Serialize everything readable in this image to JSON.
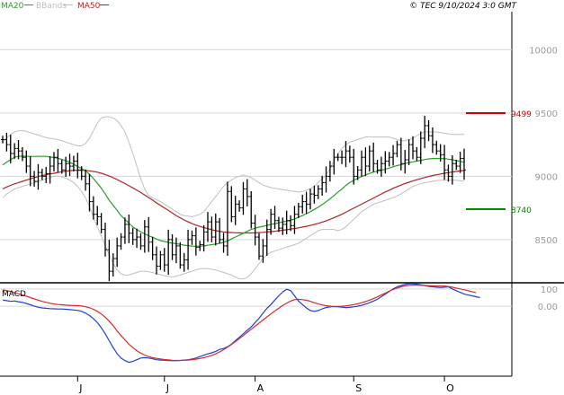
{
  "header": {
    "legend": [
      {
        "label": "MA20",
        "color": "#2a9d2a"
      },
      {
        "label": "BBands",
        "color": "#bfbfbf"
      },
      {
        "label": "MA50",
        "color": "#b22222"
      }
    ],
    "copyright": "© TEC 9/10/2024 3:0 GMT"
  },
  "chart_data": [
    {
      "type": "line",
      "panel": "price",
      "title": "",
      "ylim": [
        8180,
        10300
      ],
      "y_ticks": [
        {
          "value": 10000,
          "label": "10000"
        },
        {
          "value": 9500,
          "label": "9500"
        },
        {
          "value": 9000,
          "label": "9000"
        },
        {
          "value": 8500,
          "label": "8500"
        }
      ],
      "x_ticks": [
        "J",
        "J",
        "A",
        "S",
        "O"
      ],
      "n_sessions": 118,
      "tick_sessions": [
        19,
        41,
        64,
        89,
        112
      ],
      "levels": [
        {
          "label": "9499",
          "value": 9499,
          "color": "#cc0000"
        },
        {
          "label": "8740",
          "value": 8740,
          "color": "#008800"
        }
      ],
      "series": [
        {
          "name": "close",
          "color": "#000000",
          "values": [
            9290,
            9250,
            9180,
            9220,
            9200,
            9150,
            9080,
            9000,
            8960,
            9030,
            9000,
            9020,
            9080,
            9150,
            9100,
            9050,
            9100,
            9080,
            9120,
            9050,
            9000,
            8940,
            8800,
            8700,
            8680,
            8580,
            8420,
            8250,
            8350,
            8450,
            8520,
            8620,
            8550,
            8500,
            8520,
            8450,
            8600,
            8480,
            8380,
            8290,
            8380,
            8300,
            8500,
            8380,
            8450,
            8300,
            8340,
            8500,
            8530,
            8440,
            8460,
            8560,
            8640,
            8520,
            8640,
            8500,
            8450,
            8880,
            8680,
            8780,
            8750,
            8900,
            8840,
            8630,
            8520,
            8370,
            8450,
            8580,
            8700,
            8650,
            8590,
            8620,
            8650,
            8610,
            8700,
            8760,
            8800,
            8780,
            8860,
            8850,
            8900,
            8950,
            9000,
            9080,
            9150,
            9150,
            9150,
            9200,
            9150,
            9000,
            9050,
            9150,
            9080,
            9200,
            9100,
            9050,
            9100,
            9120,
            9150,
            9180,
            9250,
            9100,
            9130,
            9250,
            9200,
            9150,
            9300,
            9400,
            9320,
            9250,
            9200,
            9170,
            9050,
            9000,
            9100,
            9080,
            9140,
            9050
          ]
        },
        {
          "name": "MA20",
          "color": "#2a9d2a",
          "values": [
            9090,
            9112,
            9132,
            9150,
            9158,
            9159,
            9158,
            9157,
            9157,
            9157,
            9157,
            9157,
            9152,
            9148,
            9142,
            9133,
            9124,
            9110,
            9095,
            9077,
            9061,
            9042,
            9015,
            8982,
            8946,
            8906,
            8860,
            8810,
            8770,
            8730,
            8690,
            8660,
            8630,
            8600,
            8580,
            8560,
            8545,
            8530,
            8518,
            8505,
            8492,
            8485,
            8478,
            8472,
            8468,
            8462,
            8456,
            8452,
            8449,
            8448,
            8448,
            8450,
            8455,
            8460,
            8465,
            8470,
            8478,
            8490,
            8505,
            8520,
            8535,
            8550,
            8565,
            8580,
            8590,
            8598,
            8605,
            8612,
            8620,
            8626,
            8632,
            8640,
            8645,
            8653,
            8662,
            8676,
            8690,
            8705,
            8720,
            8738,
            8756,
            8776,
            8798,
            8822,
            8848,
            8874,
            8900,
            8927,
            8950,
            8968,
            8984,
            8998,
            9010,
            9022,
            9033,
            9040,
            9047,
            9055,
            9065,
            9075,
            9084,
            9092,
            9100,
            9108,
            9114,
            9120,
            9126,
            9132,
            9137,
            9140,
            9141,
            9140,
            9139,
            9135,
            9130,
            9124,
            9118,
            9110
          ]
        },
        {
          "name": "MA50",
          "color": "#b22222",
          "values": [
            8900,
            8915,
            8928,
            8940,
            8950,
            8960,
            8970,
            8980,
            8990,
            8998,
            9005,
            9012,
            9018,
            9024,
            9030,
            9036,
            9040,
            9044,
            9047,
            9048,
            9048,
            9046,
            9043,
            9038,
            9032,
            9024,
            9014,
            9002,
            8988,
            8974,
            8958,
            8942,
            8925,
            8908,
            8890,
            8872,
            8852,
            8832,
            8812,
            8790,
            8770,
            8750,
            8730,
            8710,
            8690,
            8672,
            8655,
            8640,
            8626,
            8614,
            8604,
            8594,
            8586,
            8578,
            8571,
            8565,
            8560,
            8557,
            8556,
            8554,
            8553,
            8552,
            8552,
            8552,
            8553,
            8555,
            8557,
            8560,
            8563,
            8566,
            8570,
            8574,
            8578,
            8583,
            8588,
            8593,
            8599,
            8605,
            8612,
            8620,
            8628,
            8638,
            8648,
            8660,
            8672,
            8686,
            8700,
            8716,
            8732,
            8748,
            8764,
            8780,
            8796,
            8812,
            8828,
            8844,
            8860,
            8876,
            8890,
            8905,
            8918,
            8930,
            8942,
            8953,
            8963,
            8973,
            8982,
            8990,
            8998,
            9006,
            9012,
            9018,
            9024,
            9029,
            9034,
            9038,
            9042,
            9046
          ]
        },
        {
          "name": "BBands upper",
          "color": "#bfbfbf",
          "values": [
            9270,
            9300,
            9330,
            9350,
            9360,
            9360,
            9355,
            9345,
            9335,
            9325,
            9315,
            9305,
            9300,
            9295,
            9290,
            9280,
            9270,
            9260,
            9250,
            9240,
            9240,
            9260,
            9300,
            9360,
            9420,
            9460,
            9470,
            9470,
            9460,
            9440,
            9400,
            9350,
            9270,
            9180,
            9080,
            8980,
            8900,
            8850,
            8830,
            8815,
            8800,
            8780,
            8760,
            8740,
            8720,
            8700,
            8690,
            8685,
            8680,
            8690,
            8700,
            8720,
            8760,
            8800,
            8840,
            8880,
            8920,
            8950,
            8970,
            8990,
            9000,
            9010,
            9000,
            8990,
            8970,
            8950,
            8930,
            8920,
            8910,
            8905,
            8900,
            8895,
            8890,
            8885,
            8880,
            8875,
            8880,
            8890,
            8900,
            8920,
            8950,
            8980,
            9010,
            9060,
            9120,
            9180,
            9220,
            9250,
            9270,
            9280,
            9290,
            9300,
            9310,
            9310,
            9310,
            9310,
            9310,
            9310,
            9310,
            9300,
            9290,
            9280,
            9280,
            9290,
            9300,
            9320,
            9340,
            9350,
            9350,
            9350,
            9350,
            9345,
            9340,
            9335,
            9330,
            9330,
            9330,
            9330
          ]
        },
        {
          "name": "BBands lower",
          "color": "#bfbfbf",
          "values": [
            8830,
            8860,
            8880,
            8900,
            8910,
            8920,
            8930,
            8940,
            8950,
            8960,
            8970,
            8980,
            8990,
            9000,
            9000,
            8995,
            8985,
            8970,
            8950,
            8920,
            8880,
            8830,
            8760,
            8680,
            8600,
            8530,
            8450,
            8380,
            8310,
            8260,
            8230,
            8220,
            8220,
            8230,
            8240,
            8250,
            8250,
            8245,
            8240,
            8230,
            8225,
            8215,
            8210,
            8205,
            8210,
            8220,
            8230,
            8240,
            8250,
            8260,
            8270,
            8270,
            8270,
            8265,
            8260,
            8250,
            8240,
            8230,
            8220,
            8205,
            8190,
            8190,
            8200,
            8230,
            8270,
            8310,
            8350,
            8380,
            8400,
            8410,
            8420,
            8430,
            8440,
            8450,
            8460,
            8470,
            8490,
            8510,
            8530,
            8550,
            8570,
            8580,
            8580,
            8580,
            8580,
            8570,
            8580,
            8600,
            8630,
            8660,
            8690,
            8720,
            8740,
            8760,
            8780,
            8790,
            8800,
            8810,
            8820,
            8830,
            8845,
            8860,
            8880,
            8900,
            8920,
            8930,
            8940,
            8950,
            8955,
            8960,
            8965,
            8968,
            8970,
            8970,
            8970,
            8968,
            8965,
            8960
          ]
        }
      ]
    },
    {
      "type": "line",
      "panel": "MACD",
      "title": "MACD",
      "ylim": [
        -400,
        120
      ],
      "y_ticks": [
        {
          "value": 100,
          "label": "100"
        },
        {
          "value": 0,
          "label": "0.00"
        }
      ],
      "series": [
        {
          "name": "MACD",
          "color": "#1f3fd6",
          "values": [
            35,
            32,
            28,
            30,
            26,
            22,
            16,
            8,
            0,
            -6,
            -10,
            -12,
            -14,
            -15,
            -16,
            -16,
            -18,
            -20,
            -22,
            -24,
            -30,
            -40,
            -54,
            -72,
            -95,
            -125,
            -160,
            -200,
            -240,
            -275,
            -300,
            -315,
            -325,
            -320,
            -310,
            -300,
            -298,
            -300,
            -305,
            -310,
            -312,
            -313,
            -315,
            -316,
            -316,
            -314,
            -312,
            -310,
            -306,
            -300,
            -292,
            -284,
            -276,
            -270,
            -262,
            -250,
            -245,
            -235,
            -220,
            -200,
            -180,
            -160,
            -140,
            -120,
            -95,
            -70,
            -40,
            -12,
            10,
            35,
            60,
            82,
            98,
            90,
            60,
            30,
            10,
            -10,
            -25,
            -30,
            -25,
            -15,
            -8,
            -4,
            -2,
            -4,
            -6,
            -8,
            -7,
            -4,
            0,
            5,
            12,
            20,
            30,
            40,
            55,
            70,
            85,
            100,
            112,
            120,
            126,
            130,
            130,
            128,
            124,
            120,
            115,
            112,
            110,
            108,
            110,
            112,
            100,
            90,
            80,
            70,
            65,
            60,
            55,
            50
          ]
        },
        {
          "name": "Signal",
          "color": "#d62a2a",
          "values": [
            95,
            90,
            85,
            78,
            72,
            65,
            58,
            50,
            42,
            35,
            28,
            22,
            17,
            13,
            10,
            8,
            6,
            5,
            4,
            3,
            1,
            -3,
            -9,
            -18,
            -30,
            -45,
            -64,
            -87,
            -113,
            -143,
            -170,
            -195,
            -220,
            -240,
            -258,
            -272,
            -283,
            -292,
            -298,
            -302,
            -306,
            -309,
            -311,
            -313,
            -314,
            -314,
            -313,
            -312,
            -310,
            -307,
            -303,
            -298,
            -292,
            -285,
            -276,
            -265,
            -252,
            -238,
            -222,
            -205,
            -188,
            -170,
            -152,
            -134,
            -116,
            -98,
            -80,
            -62,
            -45,
            -28,
            -12,
            4,
            18,
            30,
            38,
            40,
            38,
            34,
            28,
            20,
            13,
            7,
            3,
            0,
            -1,
            -1,
            0,
            2,
            5,
            9,
            14,
            20,
            27,
            35,
            44,
            54,
            65,
            76,
            87,
            97,
            105,
            112,
            118,
            121,
            122,
            122,
            121,
            120,
            119,
            118,
            117,
            117,
            117,
            114,
            110,
            105,
            100,
            95,
            90,
            84,
            78
          ]
        }
      ]
    }
  ]
}
